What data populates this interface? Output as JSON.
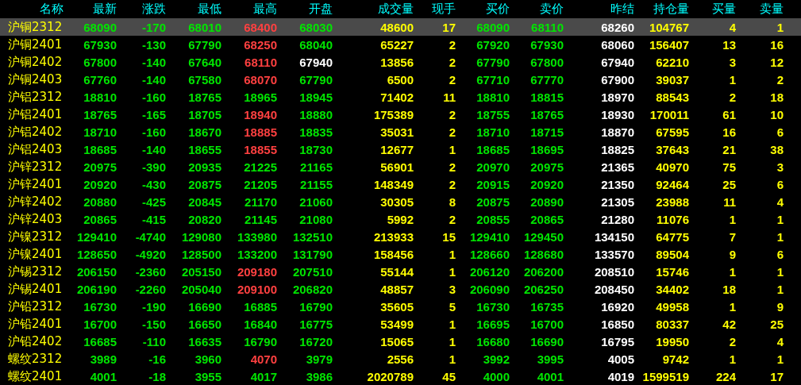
{
  "columns": [
    {
      "label": "名称"
    },
    {
      "label": "最新"
    },
    {
      "label": "涨跌"
    },
    {
      "label": "最低"
    },
    {
      "label": "最高"
    },
    {
      "label": "开盘"
    },
    {
      "label": "成交量"
    },
    {
      "label": "现手"
    },
    {
      "label": "买价"
    },
    {
      "label": "卖价"
    },
    {
      "label": "昨结"
    },
    {
      "label": "持仓量"
    },
    {
      "label": "买量"
    },
    {
      "label": "卖量"
    }
  ],
  "rows": [
    {
      "name": "沪铜2312",
      "selected": true,
      "cells": [
        {
          "text": "68090",
          "color": "#00e600"
        },
        {
          "text": "-170",
          "color": "#00e600"
        },
        {
          "text": "68010",
          "color": "#00e600"
        },
        {
          "text": "68400",
          "color": "#ff4040"
        },
        {
          "text": "68030",
          "color": "#00e600"
        },
        {
          "text": "48600",
          "color": "#ffff00"
        },
        {
          "text": "17",
          "color": "#ffff00"
        },
        {
          "text": "68090",
          "color": "#00e600"
        },
        {
          "text": "68110",
          "color": "#00e600"
        },
        {
          "text": "68260",
          "color": "#ffffff"
        },
        {
          "text": "104767",
          "color": "#ffff00"
        },
        {
          "text": "4",
          "color": "#ffff00"
        },
        {
          "text": "1",
          "color": "#ffff00"
        }
      ]
    },
    {
      "name": "沪铜2401",
      "selected": false,
      "cells": [
        {
          "text": "67930",
          "color": "#00e600"
        },
        {
          "text": "-130",
          "color": "#00e600"
        },
        {
          "text": "67790",
          "color": "#00e600"
        },
        {
          "text": "68250",
          "color": "#ff4040"
        },
        {
          "text": "68040",
          "color": "#00e600"
        },
        {
          "text": "65227",
          "color": "#ffff00"
        },
        {
          "text": "2",
          "color": "#ffff00"
        },
        {
          "text": "67920",
          "color": "#00e600"
        },
        {
          "text": "67930",
          "color": "#00e600"
        },
        {
          "text": "68060",
          "color": "#ffffff"
        },
        {
          "text": "156407",
          "color": "#ffff00"
        },
        {
          "text": "13",
          "color": "#ffff00"
        },
        {
          "text": "16",
          "color": "#ffff00"
        }
      ]
    },
    {
      "name": "沪铜2402",
      "selected": false,
      "cells": [
        {
          "text": "67800",
          "color": "#00e600"
        },
        {
          "text": "-140",
          "color": "#00e600"
        },
        {
          "text": "67640",
          "color": "#00e600"
        },
        {
          "text": "68110",
          "color": "#ff4040"
        },
        {
          "text": "67940",
          "color": "#ffffff"
        },
        {
          "text": "13856",
          "color": "#ffff00"
        },
        {
          "text": "2",
          "color": "#ffff00"
        },
        {
          "text": "67790",
          "color": "#00e600"
        },
        {
          "text": "67800",
          "color": "#00e600"
        },
        {
          "text": "67940",
          "color": "#ffffff"
        },
        {
          "text": "62210",
          "color": "#ffff00"
        },
        {
          "text": "3",
          "color": "#ffff00"
        },
        {
          "text": "12",
          "color": "#ffff00"
        }
      ]
    },
    {
      "name": "沪铜2403",
      "selected": false,
      "cells": [
        {
          "text": "67760",
          "color": "#00e600"
        },
        {
          "text": "-140",
          "color": "#00e600"
        },
        {
          "text": "67580",
          "color": "#00e600"
        },
        {
          "text": "68070",
          "color": "#ff4040"
        },
        {
          "text": "67790",
          "color": "#00e600"
        },
        {
          "text": "6500",
          "color": "#ffff00"
        },
        {
          "text": "2",
          "color": "#ffff00"
        },
        {
          "text": "67710",
          "color": "#00e600"
        },
        {
          "text": "67770",
          "color": "#00e600"
        },
        {
          "text": "67900",
          "color": "#ffffff"
        },
        {
          "text": "39037",
          "color": "#ffff00"
        },
        {
          "text": "1",
          "color": "#ffff00"
        },
        {
          "text": "2",
          "color": "#ffff00"
        }
      ]
    },
    {
      "name": "沪铝2312",
      "selected": false,
      "cells": [
        {
          "text": "18810",
          "color": "#00e600"
        },
        {
          "text": "-160",
          "color": "#00e600"
        },
        {
          "text": "18765",
          "color": "#00e600"
        },
        {
          "text": "18965",
          "color": "#00e600"
        },
        {
          "text": "18945",
          "color": "#00e600"
        },
        {
          "text": "71402",
          "color": "#ffff00"
        },
        {
          "text": "11",
          "color": "#ffff00"
        },
        {
          "text": "18810",
          "color": "#00e600"
        },
        {
          "text": "18815",
          "color": "#00e600"
        },
        {
          "text": "18970",
          "color": "#ffffff"
        },
        {
          "text": "88543",
          "color": "#ffff00"
        },
        {
          "text": "2",
          "color": "#ffff00"
        },
        {
          "text": "18",
          "color": "#ffff00"
        }
      ]
    },
    {
      "name": "沪铝2401",
      "selected": false,
      "cells": [
        {
          "text": "18765",
          "color": "#00e600"
        },
        {
          "text": "-165",
          "color": "#00e600"
        },
        {
          "text": "18705",
          "color": "#00e600"
        },
        {
          "text": "18940",
          "color": "#ff4040"
        },
        {
          "text": "18880",
          "color": "#00e600"
        },
        {
          "text": "175389",
          "color": "#ffff00"
        },
        {
          "text": "2",
          "color": "#ffff00"
        },
        {
          "text": "18755",
          "color": "#00e600"
        },
        {
          "text": "18765",
          "color": "#00e600"
        },
        {
          "text": "18930",
          "color": "#ffffff"
        },
        {
          "text": "170011",
          "color": "#ffff00"
        },
        {
          "text": "61",
          "color": "#ffff00"
        },
        {
          "text": "10",
          "color": "#ffff00"
        }
      ]
    },
    {
      "name": "沪铝2402",
      "selected": false,
      "cells": [
        {
          "text": "18710",
          "color": "#00e600"
        },
        {
          "text": "-160",
          "color": "#00e600"
        },
        {
          "text": "18670",
          "color": "#00e600"
        },
        {
          "text": "18885",
          "color": "#ff4040"
        },
        {
          "text": "18835",
          "color": "#00e600"
        },
        {
          "text": "35031",
          "color": "#ffff00"
        },
        {
          "text": "2",
          "color": "#ffff00"
        },
        {
          "text": "18710",
          "color": "#00e600"
        },
        {
          "text": "18715",
          "color": "#00e600"
        },
        {
          "text": "18870",
          "color": "#ffffff"
        },
        {
          "text": "67595",
          "color": "#ffff00"
        },
        {
          "text": "16",
          "color": "#ffff00"
        },
        {
          "text": "6",
          "color": "#ffff00"
        }
      ]
    },
    {
      "name": "沪铝2403",
      "selected": false,
      "cells": [
        {
          "text": "18685",
          "color": "#00e600"
        },
        {
          "text": "-140",
          "color": "#00e600"
        },
        {
          "text": "18655",
          "color": "#00e600"
        },
        {
          "text": "18855",
          "color": "#ff4040"
        },
        {
          "text": "18730",
          "color": "#00e600"
        },
        {
          "text": "12677",
          "color": "#ffff00"
        },
        {
          "text": "1",
          "color": "#ffff00"
        },
        {
          "text": "18685",
          "color": "#00e600"
        },
        {
          "text": "18695",
          "color": "#00e600"
        },
        {
          "text": "18825",
          "color": "#ffffff"
        },
        {
          "text": "37643",
          "color": "#ffff00"
        },
        {
          "text": "21",
          "color": "#ffff00"
        },
        {
          "text": "38",
          "color": "#ffff00"
        }
      ]
    },
    {
      "name": "沪锌2312",
      "selected": false,
      "cells": [
        {
          "text": "20975",
          "color": "#00e600"
        },
        {
          "text": "-390",
          "color": "#00e600"
        },
        {
          "text": "20935",
          "color": "#00e600"
        },
        {
          "text": "21225",
          "color": "#00e600"
        },
        {
          "text": "21165",
          "color": "#00e600"
        },
        {
          "text": "56901",
          "color": "#ffff00"
        },
        {
          "text": "2",
          "color": "#ffff00"
        },
        {
          "text": "20970",
          "color": "#00e600"
        },
        {
          "text": "20975",
          "color": "#00e600"
        },
        {
          "text": "21365",
          "color": "#ffffff"
        },
        {
          "text": "40970",
          "color": "#ffff00"
        },
        {
          "text": "75",
          "color": "#ffff00"
        },
        {
          "text": "3",
          "color": "#ffff00"
        }
      ]
    },
    {
      "name": "沪锌2401",
      "selected": false,
      "cells": [
        {
          "text": "20920",
          "color": "#00e600"
        },
        {
          "text": "-430",
          "color": "#00e600"
        },
        {
          "text": "20875",
          "color": "#00e600"
        },
        {
          "text": "21205",
          "color": "#00e600"
        },
        {
          "text": "21155",
          "color": "#00e600"
        },
        {
          "text": "148349",
          "color": "#ffff00"
        },
        {
          "text": "2",
          "color": "#ffff00"
        },
        {
          "text": "20915",
          "color": "#00e600"
        },
        {
          "text": "20920",
          "color": "#00e600"
        },
        {
          "text": "21350",
          "color": "#ffffff"
        },
        {
          "text": "92464",
          "color": "#ffff00"
        },
        {
          "text": "25",
          "color": "#ffff00"
        },
        {
          "text": "6",
          "color": "#ffff00"
        }
      ]
    },
    {
      "name": "沪锌2402",
      "selected": false,
      "cells": [
        {
          "text": "20880",
          "color": "#00e600"
        },
        {
          "text": "-425",
          "color": "#00e600"
        },
        {
          "text": "20845",
          "color": "#00e600"
        },
        {
          "text": "21170",
          "color": "#00e600"
        },
        {
          "text": "21060",
          "color": "#00e600"
        },
        {
          "text": "30305",
          "color": "#ffff00"
        },
        {
          "text": "8",
          "color": "#ffff00"
        },
        {
          "text": "20875",
          "color": "#00e600"
        },
        {
          "text": "20890",
          "color": "#00e600"
        },
        {
          "text": "21305",
          "color": "#ffffff"
        },
        {
          "text": "23988",
          "color": "#ffff00"
        },
        {
          "text": "11",
          "color": "#ffff00"
        },
        {
          "text": "4",
          "color": "#ffff00"
        }
      ]
    },
    {
      "name": "沪锌2403",
      "selected": false,
      "cells": [
        {
          "text": "20865",
          "color": "#00e600"
        },
        {
          "text": "-415",
          "color": "#00e600"
        },
        {
          "text": "20820",
          "color": "#00e600"
        },
        {
          "text": "21145",
          "color": "#00e600"
        },
        {
          "text": "21080",
          "color": "#00e600"
        },
        {
          "text": "5992",
          "color": "#ffff00"
        },
        {
          "text": "2",
          "color": "#ffff00"
        },
        {
          "text": "20855",
          "color": "#00e600"
        },
        {
          "text": "20865",
          "color": "#00e600"
        },
        {
          "text": "21280",
          "color": "#ffffff"
        },
        {
          "text": "11076",
          "color": "#ffff00"
        },
        {
          "text": "1",
          "color": "#ffff00"
        },
        {
          "text": "1",
          "color": "#ffff00"
        }
      ]
    },
    {
      "name": "沪镍2312",
      "selected": false,
      "cells": [
        {
          "text": "129410",
          "color": "#00e600"
        },
        {
          "text": "-4740",
          "color": "#00e600"
        },
        {
          "text": "129080",
          "color": "#00e600"
        },
        {
          "text": "133980",
          "color": "#00e600"
        },
        {
          "text": "132510",
          "color": "#00e600"
        },
        {
          "text": "213933",
          "color": "#ffff00"
        },
        {
          "text": "15",
          "color": "#ffff00"
        },
        {
          "text": "129410",
          "color": "#00e600"
        },
        {
          "text": "129450",
          "color": "#00e600"
        },
        {
          "text": "134150",
          "color": "#ffffff"
        },
        {
          "text": "64775",
          "color": "#ffff00"
        },
        {
          "text": "7",
          "color": "#ffff00"
        },
        {
          "text": "1",
          "color": "#ffff00"
        }
      ]
    },
    {
      "name": "沪镍2401",
      "selected": false,
      "cells": [
        {
          "text": "128650",
          "color": "#00e600"
        },
        {
          "text": "-4920",
          "color": "#00e600"
        },
        {
          "text": "128500",
          "color": "#00e600"
        },
        {
          "text": "133200",
          "color": "#00e600"
        },
        {
          "text": "131790",
          "color": "#00e600"
        },
        {
          "text": "158456",
          "color": "#ffff00"
        },
        {
          "text": "1",
          "color": "#ffff00"
        },
        {
          "text": "128660",
          "color": "#00e600"
        },
        {
          "text": "128680",
          "color": "#00e600"
        },
        {
          "text": "133570",
          "color": "#ffffff"
        },
        {
          "text": "89504",
          "color": "#ffff00"
        },
        {
          "text": "9",
          "color": "#ffff00"
        },
        {
          "text": "6",
          "color": "#ffff00"
        }
      ]
    },
    {
      "name": "沪锡2312",
      "selected": false,
      "cells": [
        {
          "text": "206150",
          "color": "#00e600"
        },
        {
          "text": "-2360",
          "color": "#00e600"
        },
        {
          "text": "205150",
          "color": "#00e600"
        },
        {
          "text": "209180",
          "color": "#ff4040"
        },
        {
          "text": "207510",
          "color": "#00e600"
        },
        {
          "text": "55144",
          "color": "#ffff00"
        },
        {
          "text": "1",
          "color": "#ffff00"
        },
        {
          "text": "206120",
          "color": "#00e600"
        },
        {
          "text": "206200",
          "color": "#00e600"
        },
        {
          "text": "208510",
          "color": "#ffffff"
        },
        {
          "text": "15746",
          "color": "#ffff00"
        },
        {
          "text": "1",
          "color": "#ffff00"
        },
        {
          "text": "1",
          "color": "#ffff00"
        }
      ]
    },
    {
      "name": "沪锡2401",
      "selected": false,
      "cells": [
        {
          "text": "206190",
          "color": "#00e600"
        },
        {
          "text": "-2260",
          "color": "#00e600"
        },
        {
          "text": "205040",
          "color": "#00e600"
        },
        {
          "text": "209100",
          "color": "#ff4040"
        },
        {
          "text": "206820",
          "color": "#00e600"
        },
        {
          "text": "48857",
          "color": "#ffff00"
        },
        {
          "text": "3",
          "color": "#ffff00"
        },
        {
          "text": "206090",
          "color": "#00e600"
        },
        {
          "text": "206250",
          "color": "#00e600"
        },
        {
          "text": "208450",
          "color": "#ffffff"
        },
        {
          "text": "34402",
          "color": "#ffff00"
        },
        {
          "text": "18",
          "color": "#ffff00"
        },
        {
          "text": "1",
          "color": "#ffff00"
        }
      ]
    },
    {
      "name": "沪铅2312",
      "selected": false,
      "cells": [
        {
          "text": "16730",
          "color": "#00e600"
        },
        {
          "text": "-190",
          "color": "#00e600"
        },
        {
          "text": "16690",
          "color": "#00e600"
        },
        {
          "text": "16885",
          "color": "#00e600"
        },
        {
          "text": "16790",
          "color": "#00e600"
        },
        {
          "text": "35605",
          "color": "#ffff00"
        },
        {
          "text": "5",
          "color": "#ffff00"
        },
        {
          "text": "16730",
          "color": "#00e600"
        },
        {
          "text": "16735",
          "color": "#00e600"
        },
        {
          "text": "16920",
          "color": "#ffffff"
        },
        {
          "text": "49958",
          "color": "#ffff00"
        },
        {
          "text": "1",
          "color": "#ffff00"
        },
        {
          "text": "9",
          "color": "#ffff00"
        }
      ]
    },
    {
      "name": "沪铅2401",
      "selected": false,
      "cells": [
        {
          "text": "16700",
          "color": "#00e600"
        },
        {
          "text": "-150",
          "color": "#00e600"
        },
        {
          "text": "16650",
          "color": "#00e600"
        },
        {
          "text": "16840",
          "color": "#00e600"
        },
        {
          "text": "16775",
          "color": "#00e600"
        },
        {
          "text": "53499",
          "color": "#ffff00"
        },
        {
          "text": "1",
          "color": "#ffff00"
        },
        {
          "text": "16695",
          "color": "#00e600"
        },
        {
          "text": "16700",
          "color": "#00e600"
        },
        {
          "text": "16850",
          "color": "#ffffff"
        },
        {
          "text": "80337",
          "color": "#ffff00"
        },
        {
          "text": "42",
          "color": "#ffff00"
        },
        {
          "text": "25",
          "color": "#ffff00"
        }
      ]
    },
    {
      "name": "沪铅2402",
      "selected": false,
      "cells": [
        {
          "text": "16685",
          "color": "#00e600"
        },
        {
          "text": "-110",
          "color": "#00e600"
        },
        {
          "text": "16635",
          "color": "#00e600"
        },
        {
          "text": "16790",
          "color": "#00e600"
        },
        {
          "text": "16720",
          "color": "#00e600"
        },
        {
          "text": "15065",
          "color": "#ffff00"
        },
        {
          "text": "1",
          "color": "#ffff00"
        },
        {
          "text": "16680",
          "color": "#00e600"
        },
        {
          "text": "16690",
          "color": "#00e600"
        },
        {
          "text": "16795",
          "color": "#ffffff"
        },
        {
          "text": "19950",
          "color": "#ffff00"
        },
        {
          "text": "2",
          "color": "#ffff00"
        },
        {
          "text": "4",
          "color": "#ffff00"
        }
      ]
    },
    {
      "name": "螺纹2312",
      "selected": false,
      "cells": [
        {
          "text": "3989",
          "color": "#00e600"
        },
        {
          "text": "-16",
          "color": "#00e600"
        },
        {
          "text": "3960",
          "color": "#00e600"
        },
        {
          "text": "4070",
          "color": "#ff4040"
        },
        {
          "text": "3979",
          "color": "#00e600"
        },
        {
          "text": "2556",
          "color": "#ffff00"
        },
        {
          "text": "1",
          "color": "#ffff00"
        },
        {
          "text": "3992",
          "color": "#00e600"
        },
        {
          "text": "3995",
          "color": "#00e600"
        },
        {
          "text": "4005",
          "color": "#ffffff"
        },
        {
          "text": "9742",
          "color": "#ffff00"
        },
        {
          "text": "1",
          "color": "#ffff00"
        },
        {
          "text": "1",
          "color": "#ffff00"
        }
      ]
    },
    {
      "name": "螺纹2401",
      "selected": false,
      "cells": [
        {
          "text": "4001",
          "color": "#00e600"
        },
        {
          "text": "-18",
          "color": "#00e600"
        },
        {
          "text": "3955",
          "color": "#00e600"
        },
        {
          "text": "4017",
          "color": "#00e600"
        },
        {
          "text": "3986",
          "color": "#00e600"
        },
        {
          "text": "2020789",
          "color": "#ffff00"
        },
        {
          "text": "45",
          "color": "#ffff00"
        },
        {
          "text": "4000",
          "color": "#00e600"
        },
        {
          "text": "4001",
          "color": "#00e600"
        },
        {
          "text": "4019",
          "color": "#ffffff"
        },
        {
          "text": "1599519",
          "color": "#ffff00"
        },
        {
          "text": "224",
          "color": "#ffff00"
        },
        {
          "text": "17",
          "color": "#ffff00"
        }
      ]
    }
  ]
}
